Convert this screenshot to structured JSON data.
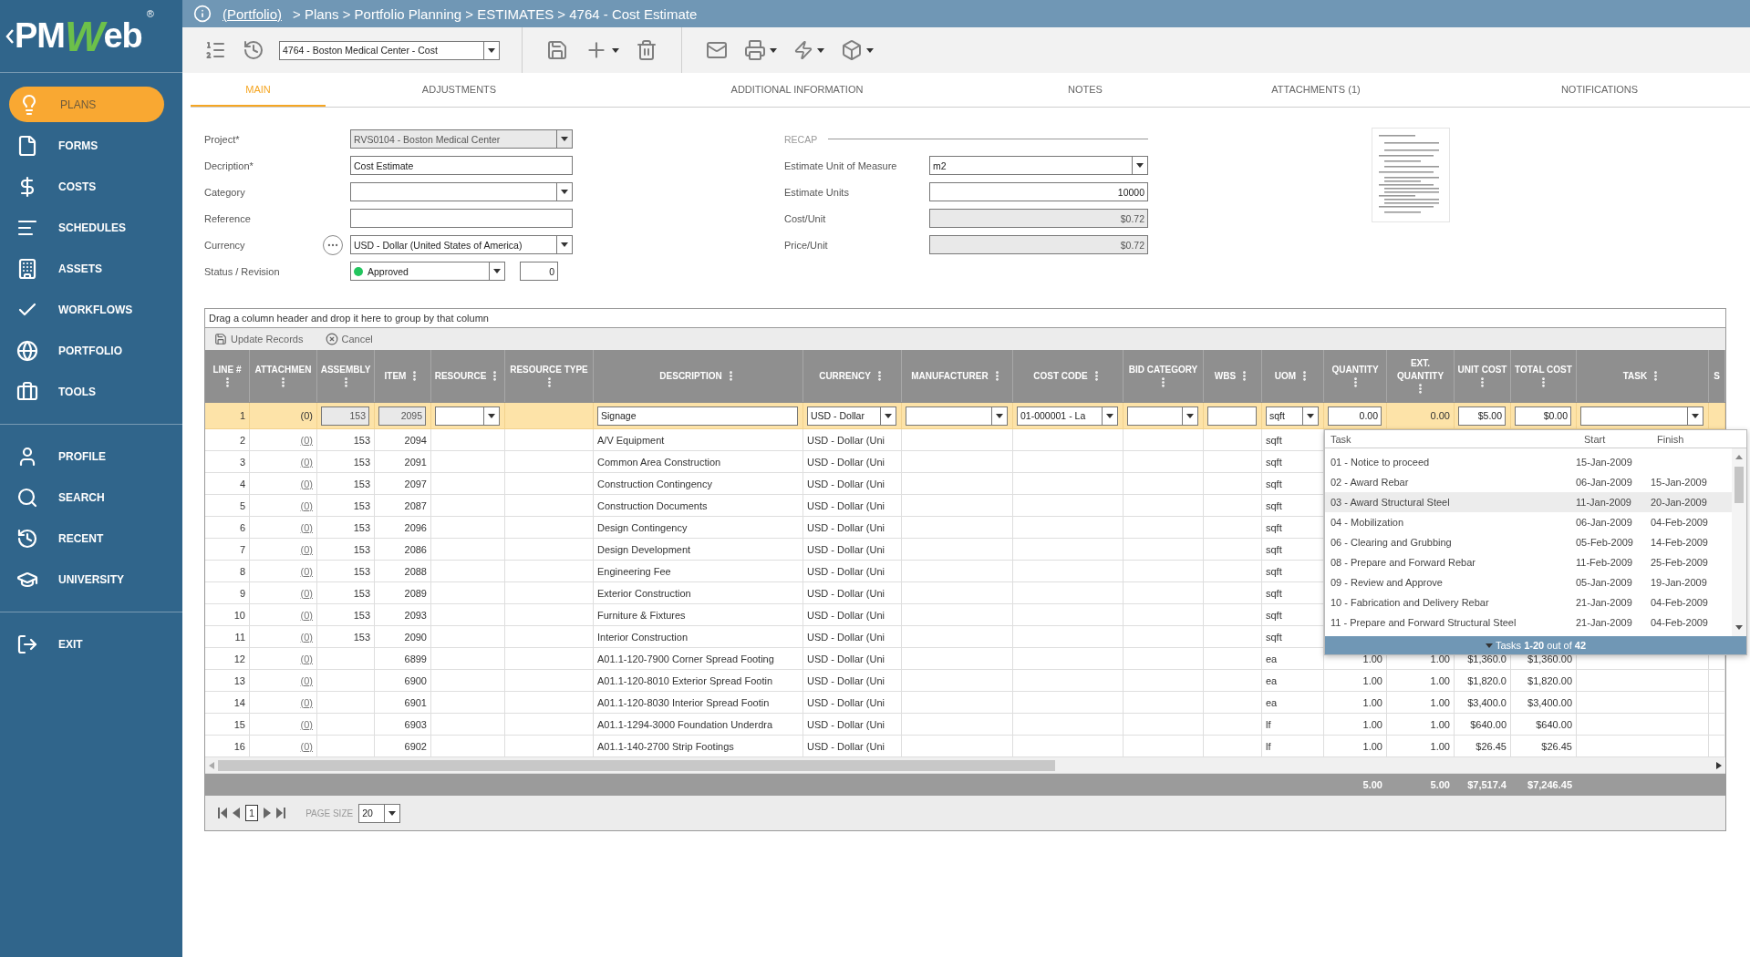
{
  "sidebar": {
    "logo": {
      "prefix": "PM",
      "accent": "W",
      "suffix": "eb",
      "mark": "®"
    },
    "sections": [
      {
        "items": [
          {
            "label": "PLANS",
            "selected": true
          },
          {
            "label": "FORMS",
            "selected": false
          },
          {
            "label": "COSTS",
            "selected": false
          },
          {
            "label": "SCHEDULES",
            "selected": false
          },
          {
            "label": "ASSETS",
            "selected": false
          },
          {
            "label": "WORKFLOWS",
            "selected": false
          },
          {
            "label": "PORTFOLIO",
            "selected": false
          },
          {
            "label": "TOOLS",
            "selected": false
          }
        ]
      },
      {
        "items": [
          {
            "label": "PROFILE",
            "selected": false
          },
          {
            "label": "SEARCH",
            "selected": false
          },
          {
            "label": "RECENT",
            "selected": false
          },
          {
            "label": "UNIVERSITY",
            "selected": false
          }
        ]
      },
      {
        "items": [
          {
            "label": "EXIT",
            "selected": false
          }
        ]
      }
    ]
  },
  "breadcrumb": {
    "link": "(Portfolio)",
    "trail": "> Plans > Portfolio Planning > ESTIMATES > 4764 - Cost Estimate"
  },
  "toolbar": {
    "record": "4764 - Boston Medical Center - Cost"
  },
  "tabs": [
    {
      "label": "MAIN",
      "selected": true
    },
    {
      "label": "ADJUSTMENTS",
      "selected": false
    },
    {
      "label": "ADDITIONAL INFORMATION",
      "selected": false
    },
    {
      "label": "NOTES",
      "selected": false
    },
    {
      "label": "ATTACHMENTS (1)",
      "selected": false
    },
    {
      "label": "NOTIFICATIONS",
      "selected": false
    }
  ],
  "form": {
    "fields": [
      {
        "label": "Project*",
        "kind": "select",
        "value": "RVS0104 - Boston Medical Center",
        "disabled": true
      },
      {
        "label": "Decription*",
        "kind": "input",
        "value": "Cost Estimate",
        "disabled": false
      },
      {
        "label": "Category",
        "kind": "select",
        "disabled": false
      },
      {
        "label": "Reference",
        "kind": "input",
        "disabled": false
      },
      {
        "label": "Currency",
        "kind": "currency",
        "value": "USD - Dollar (United States of America)",
        "disabled": false
      },
      {
        "label": "Status / Revision",
        "kind": "status",
        "value": "Approved",
        "color": "#22c55e",
        "revision": "0",
        "disabled": false
      }
    ],
    "recap": {
      "title": "RECAP",
      "fields": [
        {
          "label": "Estimate Unit of Measure",
          "kind": "select",
          "value": "m2",
          "disabled": false
        },
        {
          "label": "Estimate Units",
          "kind": "number",
          "value": "10000",
          "disabled": false
        },
        {
          "label": "Cost/Unit",
          "kind": "number",
          "value": "$0.72",
          "disabled": true
        },
        {
          "label": "Price/Unit",
          "kind": "number",
          "value": "$0.72",
          "disabled": true
        }
      ]
    }
  },
  "grid": {
    "group_hint": "Drag a column header and drop it here to group by that column",
    "actions": [
      "Update Records",
      "Cancel"
    ],
    "columns": [
      {
        "label": "LINE #",
        "menu": true
      },
      {
        "label": "ATTACHMEN",
        "menu": true
      },
      {
        "label": "ASSEMBLY",
        "menu": true
      },
      {
        "label": "ITEM",
        "menu": true
      },
      {
        "label": "RESOURCE",
        "menu": true
      },
      {
        "label": "RESOURCE TYPE",
        "menu": true
      },
      {
        "label": "DESCRIPTION",
        "menu": true
      },
      {
        "label": "CURRENCY",
        "menu": true
      },
      {
        "label": "MANUFACTURER",
        "menu": true
      },
      {
        "label": "COST CODE",
        "menu": true
      },
      {
        "label": "BID CATEGORY",
        "menu": true
      },
      {
        "label": "WBS",
        "menu": true
      },
      {
        "label": "UOM",
        "menu": true
      },
      {
        "label": "QUANTITY",
        "menu": true
      },
      {
        "label": "EXT. QUANTITY",
        "menu": true
      },
      {
        "label": "UNIT COST",
        "menu": true
      },
      {
        "label": "TOTAL COST",
        "menu": true
      },
      {
        "label": "TASK",
        "menu": true
      },
      {
        "label": "S",
        "menu": false
      }
    ],
    "edit_row": [
      {
        "kind": "text",
        "value": "1"
      },
      {
        "kind": "text",
        "value": "(0)"
      },
      {
        "kind": "input",
        "value": "153",
        "disabled": true
      },
      {
        "kind": "input",
        "value": "2095",
        "disabled": true
      },
      {
        "kind": "select",
        "disabled": false
      },
      {
        "kind": "blank"
      },
      {
        "kind": "input",
        "value": "Signage",
        "disabled": false
      },
      {
        "kind": "select",
        "value": "USD - Dollar",
        "disabled": false
      },
      {
        "kind": "select",
        "disabled": false
      },
      {
        "kind": "select",
        "value": "01-000001 - La",
        "disabled": false
      },
      {
        "kind": "select",
        "disabled": false
      },
      {
        "kind": "input",
        "disabled": false
      },
      {
        "kind": "select",
        "value": "sqft",
        "disabled": false
      },
      {
        "kind": "input",
        "value": "0.00",
        "disabled": false
      },
      {
        "kind": "text",
        "value": "0.00"
      },
      {
        "kind": "input",
        "value": "$5.00",
        "disabled": false
      },
      {
        "kind": "input",
        "value": "$0.00",
        "disabled": false
      },
      {
        "kind": "select",
        "disabled": false
      },
      {
        "kind": "blank"
      }
    ],
    "rows": [
      {
        "line": "2",
        "attachments": "(0)",
        "assembly": "153",
        "item": "2094",
        "description": "A/V Equipment",
        "currency": "USD - Dollar (Uni",
        "uom": "sqft"
      },
      {
        "line": "3",
        "attachments": "(0)",
        "assembly": "153",
        "item": "2091",
        "description": "Common Area Construction",
        "currency": "USD - Dollar (Uni",
        "uom": "sqft"
      },
      {
        "line": "4",
        "attachments": "(0)",
        "assembly": "153",
        "item": "2097",
        "description": "Construction Contingency",
        "currency": "USD - Dollar (Uni",
        "uom": "sqft"
      },
      {
        "line": "5",
        "attachments": "(0)",
        "assembly": "153",
        "item": "2087",
        "description": "Construction Documents",
        "currency": "USD - Dollar (Uni",
        "uom": "sqft"
      },
      {
        "line": "6",
        "attachments": "(0)",
        "assembly": "153",
        "item": "2096",
        "description": "Design Contingency",
        "currency": "USD - Dollar (Uni",
        "uom": "sqft"
      },
      {
        "line": "7",
        "attachments": "(0)",
        "assembly": "153",
        "item": "2086",
        "description": "Design Development",
        "currency": "USD - Dollar (Uni",
        "uom": "sqft"
      },
      {
        "line": "8",
        "attachments": "(0)",
        "assembly": "153",
        "item": "2088",
        "description": "Engineering Fee",
        "currency": "USD - Dollar (Uni",
        "uom": "sqft"
      },
      {
        "line": "9",
        "attachments": "(0)",
        "assembly": "153",
        "item": "2089",
        "description": "Exterior Construction",
        "currency": "USD - Dollar (Uni",
        "uom": "sqft"
      },
      {
        "line": "10",
        "attachments": "(0)",
        "assembly": "153",
        "item": "2093",
        "description": "Furniture & Fixtures",
        "currency": "USD - Dollar (Uni",
        "uom": "sqft"
      },
      {
        "line": "11",
        "attachments": "(0)",
        "assembly": "153",
        "item": "2090",
        "description": "Interior Construction",
        "currency": "USD - Dollar (Uni",
        "uom": "sqft"
      },
      {
        "line": "12",
        "attachments": "(0)",
        "item": "6899",
        "description": "A01.1-120-7900 Corner Spread Footing",
        "currency": "USD - Dollar (Uni",
        "uom": "ea",
        "quantity": "1.00",
        "ext_quantity": "1.00",
        "unit_cost": "$1,360.0",
        "total_cost": "$1,360.00"
      },
      {
        "line": "13",
        "attachments": "(0)",
        "item": "6900",
        "description": "A01.1-120-8010 Exterior Spread Footin",
        "currency": "USD - Dollar (Uni",
        "uom": "ea",
        "quantity": "1.00",
        "ext_quantity": "1.00",
        "unit_cost": "$1,820.0",
        "total_cost": "$1,820.00"
      },
      {
        "line": "14",
        "attachments": "(0)",
        "item": "6901",
        "description": "A01.1-120-8030 Interior Spread Footin",
        "currency": "USD - Dollar (Uni",
        "uom": "ea",
        "quantity": "1.00",
        "ext_quantity": "1.00",
        "unit_cost": "$3,400.0",
        "total_cost": "$3,400.00"
      },
      {
        "line": "15",
        "attachments": "(0)",
        "item": "6903",
        "description": "A01.1-1294-3000 Foundation Underdra",
        "currency": "USD - Dollar (Uni",
        "uom": "lf",
        "quantity": "1.00",
        "ext_quantity": "1.00",
        "unit_cost": "$640.00",
        "total_cost": "$640.00"
      },
      {
        "line": "16",
        "attachments": "(0)",
        "item": "6902",
        "description": "A01.1-140-2700 Strip Footings",
        "currency": "USD - Dollar (Uni",
        "uom": "lf",
        "quantity": "1.00",
        "ext_quantity": "1.00",
        "unit_cost": "$26.45",
        "total_cost": "$26.45"
      }
    ],
    "totals": {
      "quantity": "5.00",
      "ext_quantity": "5.00",
      "unit_cost": "$7,517.4",
      "total_cost": "$7,246.45"
    },
    "pager": {
      "page": "1",
      "page_size_label": "PAGE SIZE",
      "page_size": "20"
    }
  },
  "task_dropdown": {
    "columns": [
      "Task",
      "Start",
      "Finish"
    ],
    "items": [
      {
        "task": "01 - Notice to proceed",
        "start": "15-Jan-2009",
        "selected": false
      },
      {
        "task": "02 - Award Rebar",
        "start": "06-Jan-2009",
        "finish": "15-Jan-2009",
        "selected": false
      },
      {
        "task": "03 - Award Structural Steel",
        "start": "11-Jan-2009",
        "finish": "20-Jan-2009",
        "selected": true
      },
      {
        "task": "04 - Mobilization",
        "start": "06-Jan-2009",
        "finish": "04-Feb-2009",
        "selected": false
      },
      {
        "task": "06 - Clearing and Grubbing",
        "start": "05-Feb-2009",
        "finish": "14-Feb-2009",
        "selected": false
      },
      {
        "task": "08 - Prepare and Forward Rebar",
        "start": "11-Feb-2009",
        "finish": "25-Feb-2009",
        "selected": false
      },
      {
        "task": "09 - Review and Approve",
        "start": "05-Jan-2009",
        "finish": "19-Jan-2009",
        "selected": false
      },
      {
        "task": "10 - Fabrication and Delivery Rebar",
        "start": "21-Jan-2009",
        "finish": "04-Feb-2009",
        "selected": false
      },
      {
        "task": "11 - Prepare and Forward Structural Steel",
        "start": "21-Jan-2009",
        "finish": "04-Feb-2009",
        "selected": false
      }
    ],
    "footer": "Tasks **1-20** out of **42**"
  }
}
